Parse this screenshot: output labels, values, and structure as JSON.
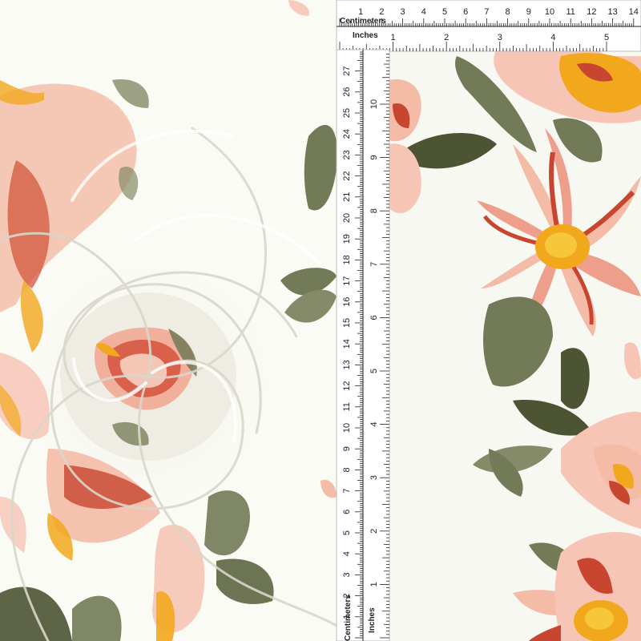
{
  "photo": {
    "colors": {
      "fabric": "#fbfbf6",
      "swirl_shadow": "#e9e8df",
      "petal_light": "#f6c5b6",
      "petal_mid": "#ee9f8c",
      "petal_red": "#c8452f",
      "flower_center": "#f2a81d",
      "leaf": "#727a57",
      "leaf_dark": "#4c5434",
      "ruler": "#ffffff",
      "ruler_ink": "#222222"
    }
  },
  "ruler_horizontal": {
    "top_label": "Centimeters",
    "bottom_label": "Inches",
    "cm_ticks": [
      "1",
      "2",
      "3",
      "4",
      "5",
      "6",
      "7",
      "8",
      "9",
      "10",
      "11",
      "12",
      "13",
      "14"
    ],
    "inch_ticks": [
      "1",
      "2",
      "3",
      "4",
      "5"
    ]
  },
  "ruler_vertical": {
    "left_label": "Centimeters",
    "right_label": "Inches",
    "cm_ticks": [
      "1",
      "2",
      "3",
      "4",
      "5",
      "6",
      "7",
      "8",
      "9",
      "10",
      "11",
      "12",
      "13",
      "14",
      "15",
      "16",
      "17",
      "18",
      "19",
      "20",
      "21",
      "22",
      "23",
      "24",
      "25",
      "26",
      "27"
    ],
    "inch_ticks": [
      "1",
      "2",
      "3",
      "4",
      "5",
      "6",
      "7",
      "8",
      "9",
      "10"
    ]
  }
}
